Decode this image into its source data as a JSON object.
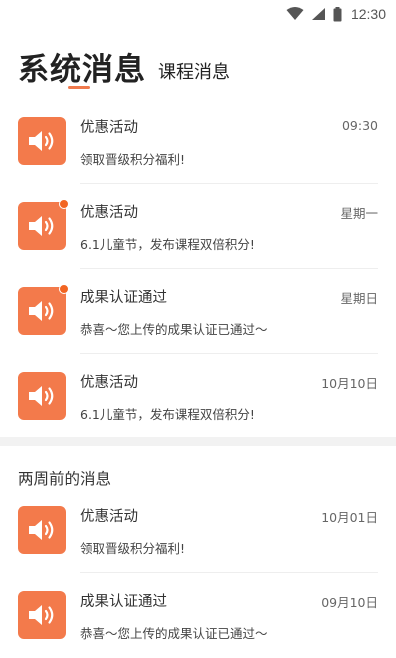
{
  "status_bar": {
    "time": "12:30",
    "icons": [
      "wifi-icon",
      "cellular-signal-icon",
      "battery-icon"
    ]
  },
  "tabs": {
    "active": "系统消息",
    "inactive": "课程消息",
    "accent_color": "#f07a4d"
  },
  "messages_recent": [
    {
      "title": "优惠活动",
      "body": "领取晋级积分福利!",
      "time": "09:30",
      "unread": false,
      "icon": "speaker-icon"
    },
    {
      "title": "优惠活动",
      "body": "6.1儿童节，发布课程双倍积分!",
      "time": "星期一",
      "unread": true,
      "icon": "speaker-icon"
    },
    {
      "title": "成果认证通过",
      "body": "恭喜～您上传的成果认证已通过～",
      "time": "星期日",
      "unread": true,
      "icon": "speaker-icon"
    },
    {
      "title": "优惠活动",
      "body": "6.1儿童节，发布课程双倍积分!",
      "time": "10月10日",
      "unread": false,
      "icon": "speaker-icon"
    }
  ],
  "section_title": "两周前的消息",
  "messages_older": [
    {
      "title": "优惠活动",
      "body": "领取晋级积分福利!",
      "time": "10月01日",
      "unread": false,
      "icon": "speaker-icon"
    },
    {
      "title": "成果认证通过",
      "body": "恭喜～您上传的成果认证已通过～",
      "time": "09月10日",
      "unread": false,
      "icon": "speaker-icon"
    }
  ],
  "colors": {
    "icon_background": "#f37a4b",
    "unread_dot": "#f26522",
    "section_gap": "#f2f2f2"
  }
}
